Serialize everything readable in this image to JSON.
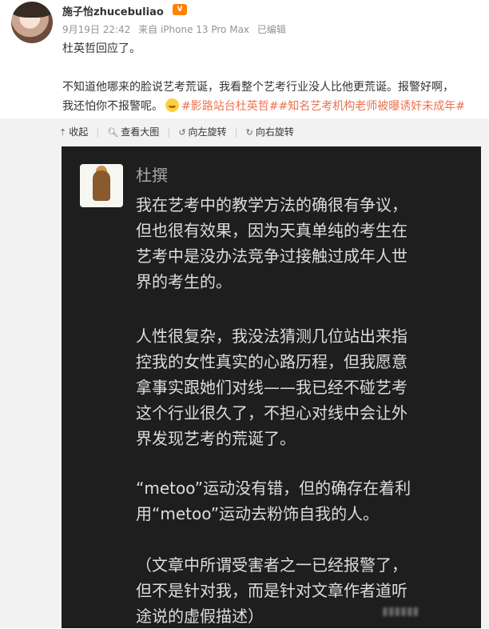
{
  "post": {
    "username": "施子怡zhucebuliao",
    "vip_badge": "V",
    "date": "9月19日 22:42",
    "source": "来自 iPhone 13 Pro Max",
    "edited": "已编辑",
    "line1": "杜英哲回应了。",
    "line2": "不知道他哪来的脸说艺考荒诞，我看整个艺考行业没人比他更荒诞。报警好啊，",
    "line3_text": "我还怕你不报警呢。",
    "hashtag1": "#影路站台杜英哲#",
    "hashtag2": "#知名艺考机构老师被曝诱奸未成年#"
  },
  "toolbar": {
    "collapse": "收起",
    "view_large": "查看大图",
    "rotate_left": "向左旋转",
    "rotate_right": "向右旋转"
  },
  "chat": {
    "name": "杜撰",
    "lines": [
      "我在艺考中的教学方法的确很有争议，",
      "但也很有效果，因为天真单纯的考生在",
      "艺考中是没办法竞争过接触过成年人世",
      "界的考生的。",
      "",
      "人性很复杂，我没法猜测几位站出来指",
      "控我的女性真实的心路历程，但我愿意",
      "拿事实跟她们对线——我已经不碰艺考",
      "这个行业很久了，不担心对线中会让外",
      "界发现艺考的荒诞了。",
      "",
      "“metoo”运动没有错，但的确存在着利",
      "用“metoo”运动去粉饰自我的人。",
      "",
      "（文章中所谓受害者之一已经报警了，",
      "但不是针对我，而是针对文章作者道听",
      "途说的虚假描述）"
    ]
  },
  "icons": {
    "collapse": "arrow-up-icon",
    "view_large": "magnifier-icon",
    "rotate_left": "rotate-left-icon",
    "rotate_right": "rotate-right-icon"
  }
}
